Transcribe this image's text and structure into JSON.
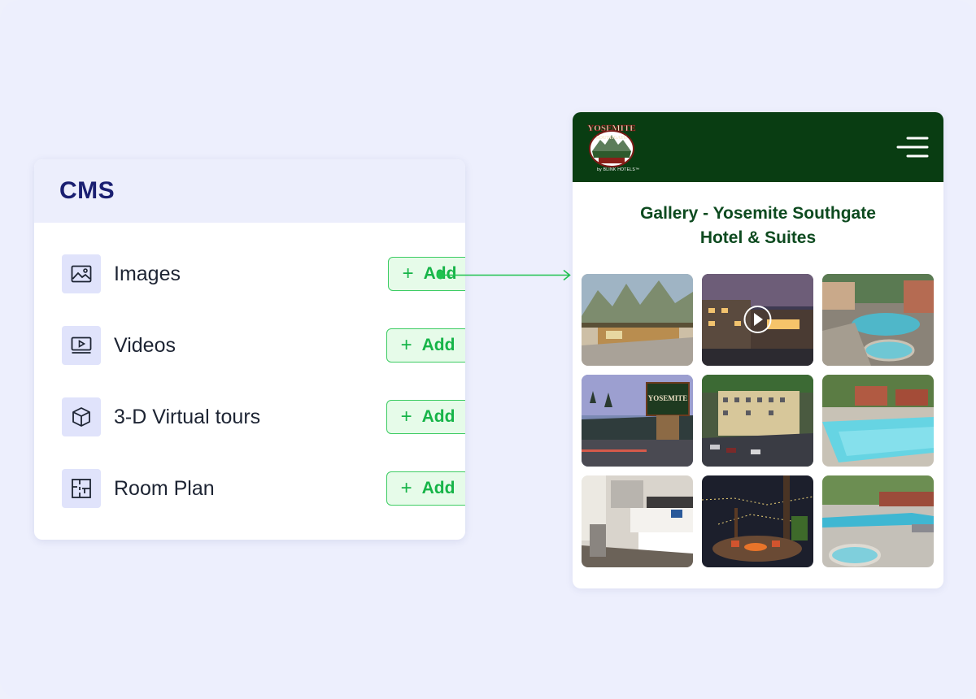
{
  "cms": {
    "title": "CMS",
    "items": [
      {
        "label": "Images",
        "icon": "image-icon",
        "add_label": "Add"
      },
      {
        "label": "Videos",
        "icon": "video-icon",
        "add_label": "Add"
      },
      {
        "label": "3-D Virtual tours",
        "icon": "cube-icon",
        "add_label": "Add"
      },
      {
        "label": "Room Plan",
        "icon": "floor-plan-icon",
        "add_label": "Add"
      }
    ]
  },
  "site": {
    "logo_text": "YOSEMITE",
    "logo_subtext": "SOUTHGATE",
    "logo_tagline": "by BLINK HOTELS™",
    "gallery_title_line1": "Gallery - Yosemite Southgate",
    "gallery_title_line2": "Hotel & Suites",
    "photos": [
      {
        "name": "lobby-mural-photo"
      },
      {
        "name": "hotel-night-exterior-video",
        "is_video": true
      },
      {
        "name": "hot-tub-photo"
      },
      {
        "name": "hotel-sign-photo"
      },
      {
        "name": "hotel-aerial-photo"
      },
      {
        "name": "pool-photo"
      },
      {
        "name": "guest-room-photo"
      },
      {
        "name": "fire-pit-photo"
      },
      {
        "name": "pool-jacuzzi-photo"
      }
    ]
  },
  "colors": {
    "accent_green": "#16b448",
    "brand_navy": "#1a1f71",
    "site_header": "#093d12"
  }
}
